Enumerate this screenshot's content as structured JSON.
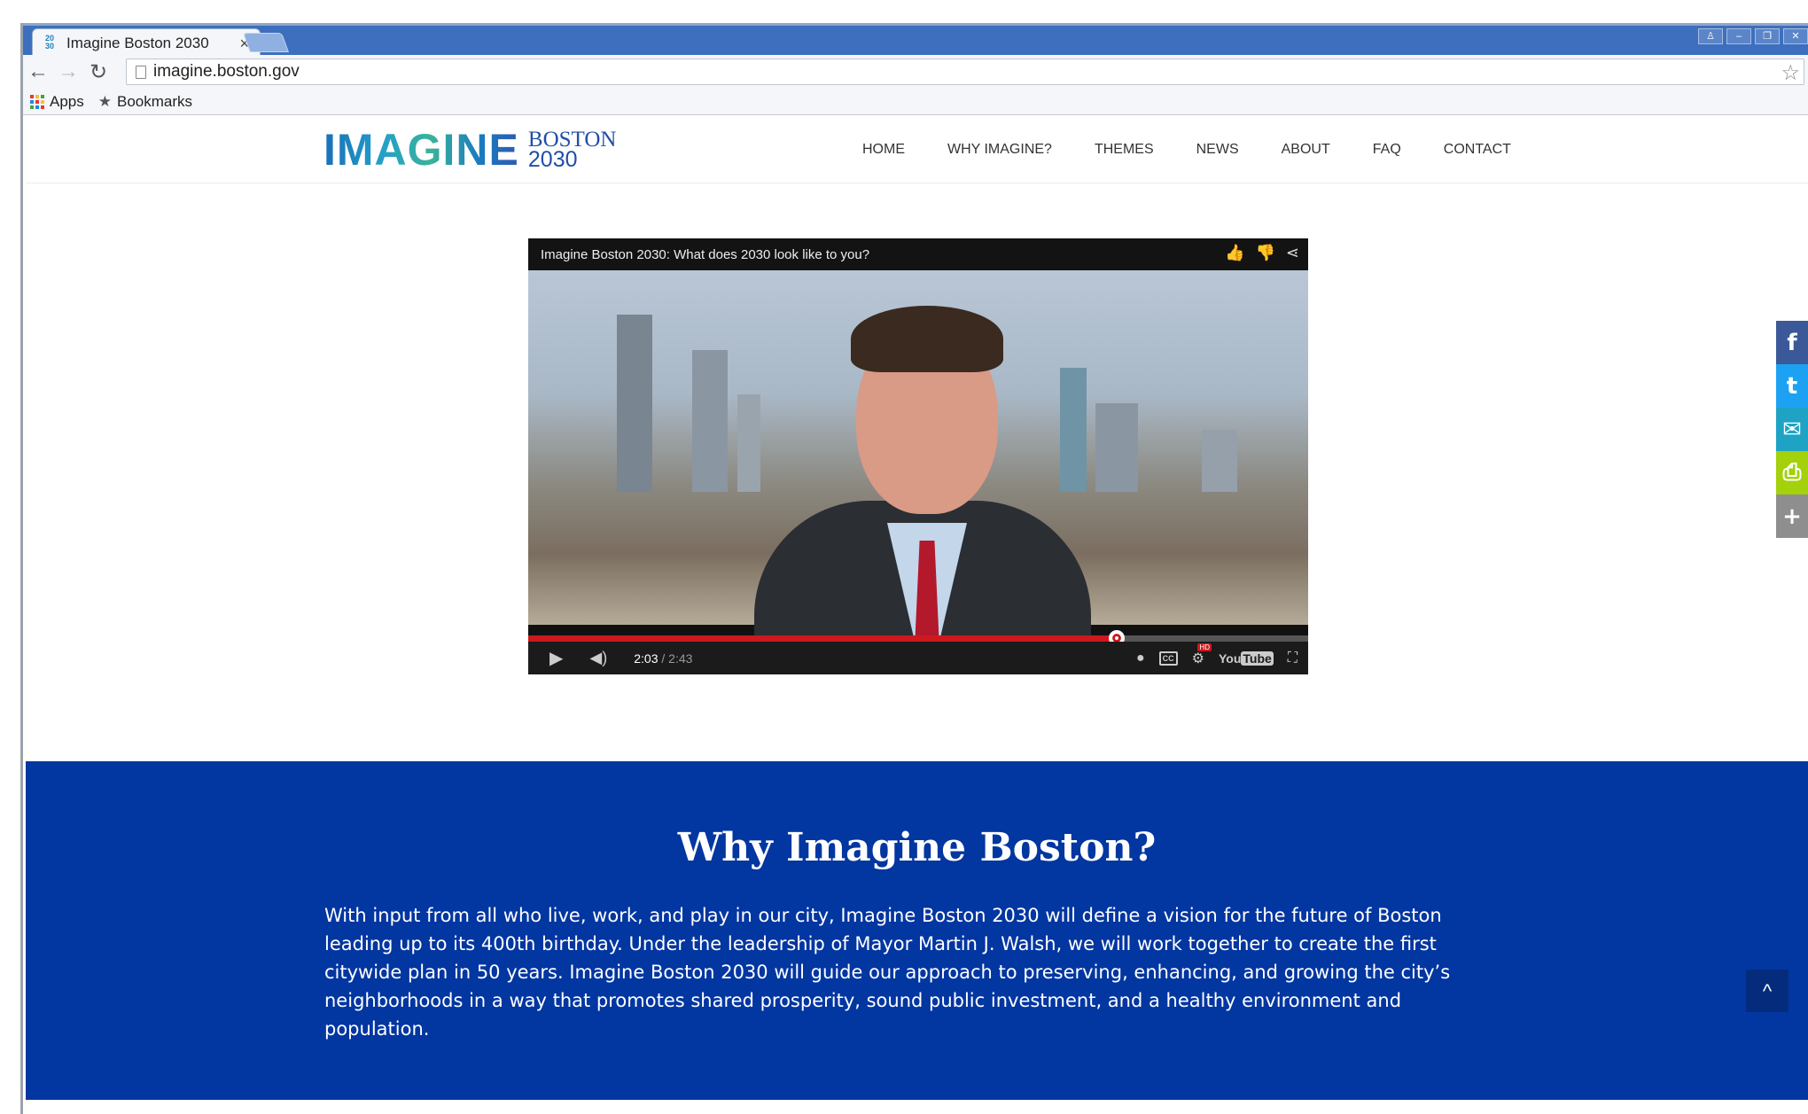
{
  "browser": {
    "tab_title": "Imagine Boston 2030",
    "tab_close": "×",
    "favicon_top": "20",
    "favicon_bottom": "30",
    "url": "imagine.boston.gov",
    "bookmarks": {
      "apps_label": "Apps",
      "bookmarks_label": "Bookmarks"
    }
  },
  "header": {
    "logo_main": "IMAGINE",
    "logo_line1": "BOSTON",
    "logo_line2": "2030",
    "nav": [
      "HOME",
      "WHY IMAGINE?",
      "THEMES",
      "NEWS",
      "ABOUT",
      "FAQ",
      "CONTACT"
    ]
  },
  "video": {
    "title": "Imagine Boston 2030: What does 2030 look like to you?",
    "current_time": "2:03",
    "duration": "/ 2:43",
    "progress_fraction": 0.754,
    "hd_badge": "HD",
    "yt_you": "You",
    "yt_tube": "Tube"
  },
  "why": {
    "title": "Why Imagine Boston?",
    "body": "With input from all who live, work, and play in our city, Imagine Boston 2030 will define a vision for the future of Boston leading up to its 400th birthday. Under the leadership of Mayor Martin J. Walsh, we will work together to create the first citywide plan in 50 years. Imagine Boston 2030 will guide our approach to preserving, enhancing, and growing the city’s neighborhoods in a way that promotes shared prosperity, sound public investment, and a healthy environment and population."
  },
  "social": [
    {
      "icon": "facebook-icon",
      "glyph": "f",
      "color": "#3b5998"
    },
    {
      "icon": "twitter-icon",
      "glyph": "t",
      "color": "#1da1f2"
    },
    {
      "icon": "email-icon",
      "glyph": "✉",
      "color": "#1fa3c4"
    },
    {
      "icon": "print-icon",
      "glyph": "⎙",
      "color": "#a3d10b"
    },
    {
      "icon": "plus-icon",
      "glyph": "+",
      "color": "#8e8e8e"
    }
  ],
  "colors": {
    "brand_blue": "#0236a1",
    "progress_red": "#cc181e"
  }
}
